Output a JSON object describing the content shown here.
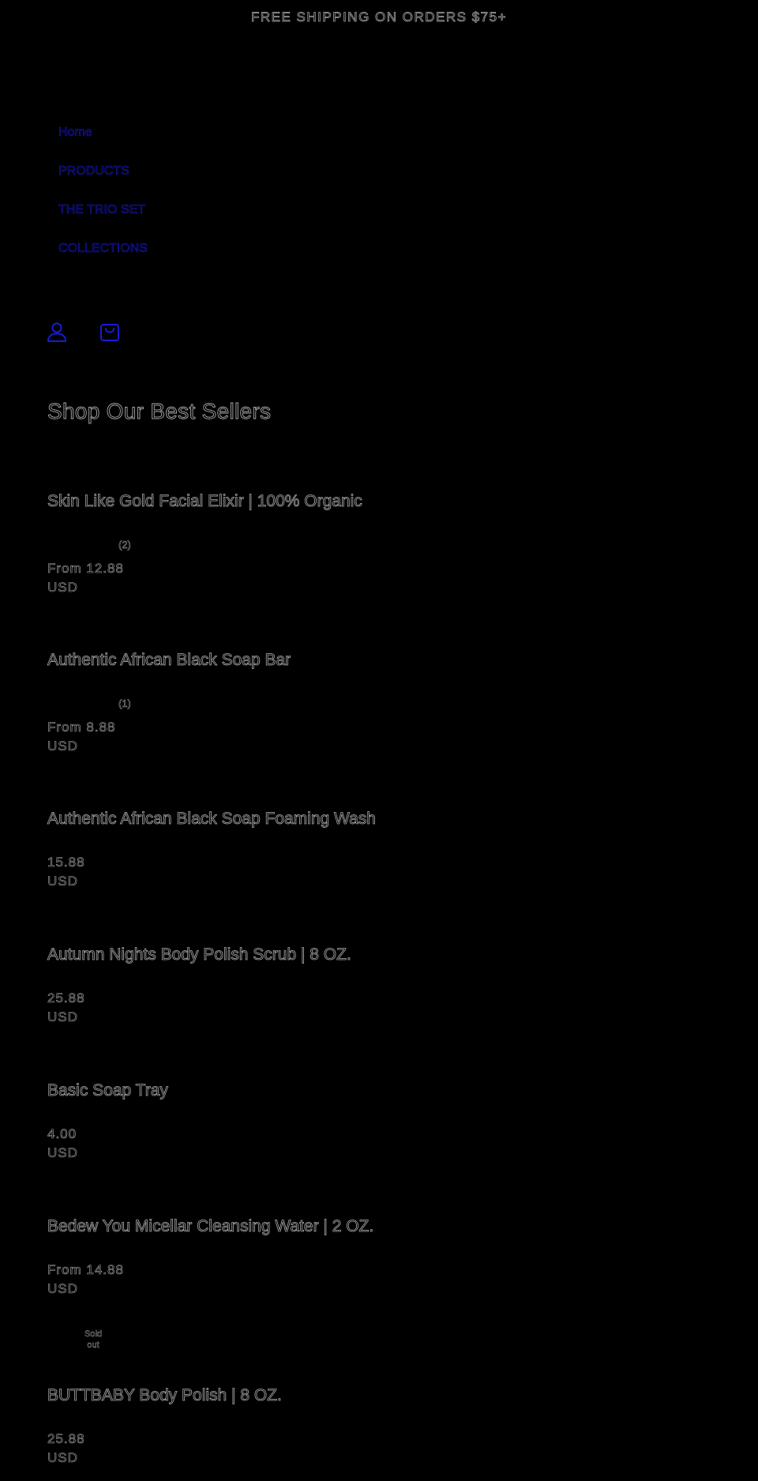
{
  "announcement": "FREE SHIPPING ON ORDERS $75+",
  "nav": {
    "items": [
      {
        "label": "Home"
      },
      {
        "label": "PRODUCTS"
      },
      {
        "label": "THE TRIO SET"
      },
      {
        "label": "COLLECTIONS"
      }
    ]
  },
  "header_icons": {
    "account": "account-icon",
    "cart": "cart-icon"
  },
  "section": {
    "title": "Shop Our Best Sellers"
  },
  "products": [
    {
      "title": "Skin Like Gold Facial Elixir | 100% Organic",
      "reviews": "(2)",
      "price": "From 12.88",
      "currency": "USD"
    },
    {
      "title": "Authentic African Black Soap Bar",
      "reviews": "(1)",
      "price": "From 8.88",
      "currency": "USD"
    },
    {
      "title": "Authentic African Black Soap Foaming Wash",
      "price": "15.88",
      "currency": "USD"
    },
    {
      "title": "Autumn Nights Body Polish Scrub | 8 OZ.",
      "price": "25.88",
      "currency": "USD"
    },
    {
      "title": "Basic Soap Tray",
      "price": "4.00",
      "currency": "USD"
    },
    {
      "title": "Bedew You Micellar Cleansing Water | 2 OZ.",
      "price": "From 14.88",
      "currency": "USD",
      "badge_line1": "Sold",
      "badge_line2": "out"
    },
    {
      "title": "BUTTBABY Body Polish | 8 OZ.",
      "price": "25.88",
      "currency": "USD"
    }
  ],
  "colors": {
    "background": "#000000",
    "text_outline": "#a8a8a8",
    "link_outline": "#1a1ad9"
  }
}
